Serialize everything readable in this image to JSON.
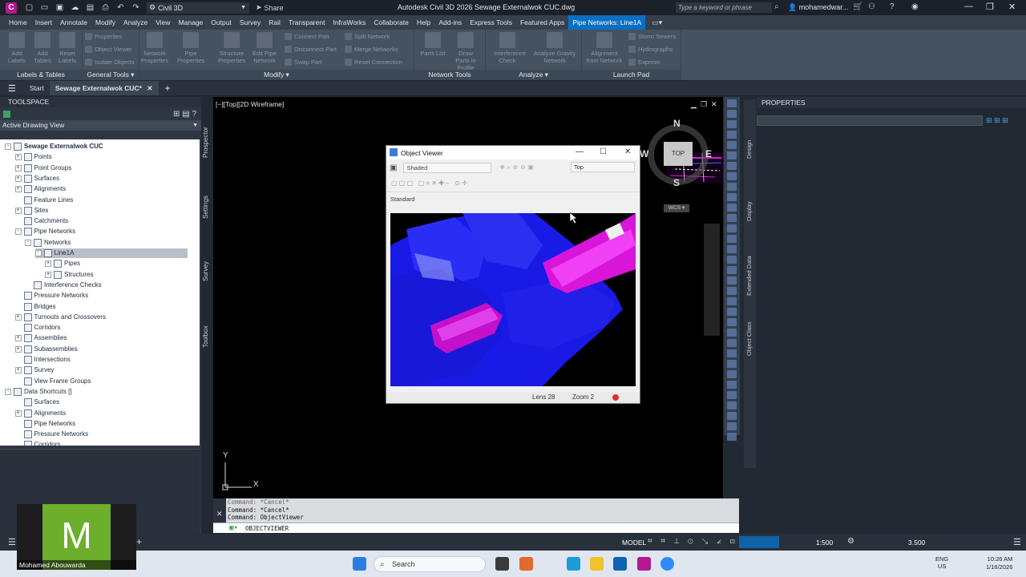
{
  "titlebar": {
    "app_letter": "C",
    "workspace": "Civil 3D",
    "share": "Share",
    "title": "Autodesk Civil 3D 2026   Sewage Externalwok CUC.dwg",
    "search_placeholder": "Type a keyword or phrase",
    "user": "mohamedwar..."
  },
  "ribbon_tabs": [
    "Home",
    "Insert",
    "Annotate",
    "Modify",
    "Analyze",
    "View",
    "Manage",
    "Output",
    "Survey",
    "Rail",
    "Transparent",
    "InfraWorks",
    "Collaborate",
    "Help",
    "Add-ins",
    "Express Tools",
    "Featured Apps",
    "Pipe Networks: Line1A"
  ],
  "ribbon": {
    "groups": [
      {
        "title": "Labels & Tables",
        "big": [
          "Add Labels",
          "Add Tables",
          "Reset Labels"
        ]
      },
      {
        "title": "General Tools ▾",
        "small": [
          "Properties",
          "Object Viewer",
          "Isolate Objects"
        ]
      },
      {
        "title": "Modify ▾",
        "big": [
          "Network Properties",
          "Pipe Properties",
          "Structure Properties",
          "Edit Pipe Network"
        ],
        "small": [
          "Connect Part",
          "Disconnect Part",
          "Swap Part",
          "Split Network",
          "Merge Networks",
          "Reset Connection"
        ]
      },
      {
        "title": "Network Tools",
        "big": [
          "Parts List",
          "Draw Parts in Profile"
        ]
      },
      {
        "title": "Analyze ▾",
        "big": [
          "Interference Check",
          "Analyze Gravity Network"
        ]
      },
      {
        "title": "Launch Pad",
        "big": [
          "Alignment from Network"
        ],
        "small": [
          "Storm Sewers",
          "Hydrographs",
          "Express"
        ]
      }
    ]
  },
  "file_tabs": [
    "Start",
    "Sewage Externalwok CUC*"
  ],
  "toolspace": {
    "title": "TOOLSPACE",
    "view_dropdown": "Active Drawing View",
    "tree": [
      {
        "label": "Sewage Externalwok CUC",
        "level": 0,
        "exp": "-",
        "bold": true
      },
      {
        "label": "Points",
        "level": 1,
        "exp": "+"
      },
      {
        "label": "Point Groups",
        "level": 1,
        "exp": "+"
      },
      {
        "label": "Surfaces",
        "level": 1,
        "exp": "+"
      },
      {
        "label": "Alignments",
        "level": 1,
        "exp": "+"
      },
      {
        "label": "Feature Lines",
        "level": 1,
        "exp": ""
      },
      {
        "label": "Sites",
        "level": 1,
        "exp": "+"
      },
      {
        "label": "Catchments",
        "level": 1,
        "exp": ""
      },
      {
        "label": "Pipe Networks",
        "level": 1,
        "exp": "-"
      },
      {
        "label": "Networks",
        "level": 2,
        "exp": "-"
      },
      {
        "label": "Line1A",
        "level": 3,
        "exp": "-",
        "selected": true
      },
      {
        "label": "Pipes",
        "level": 4,
        "exp": "+"
      },
      {
        "label": "Structures",
        "level": 4,
        "exp": "+"
      },
      {
        "label": "Interference Checks",
        "level": 2,
        "exp": ""
      },
      {
        "label": "Pressure Networks",
        "level": 1,
        "exp": ""
      },
      {
        "label": "Bridges",
        "level": 1,
        "exp": ""
      },
      {
        "label": "Turnouts and Crossovers",
        "level": 1,
        "exp": "+"
      },
      {
        "label": "Corridors",
        "level": 1,
        "exp": ""
      },
      {
        "label": "Assemblies",
        "level": 1,
        "exp": "+"
      },
      {
        "label": "Subassemblies",
        "level": 1,
        "exp": "+"
      },
      {
        "label": "Intersections",
        "level": 1,
        "exp": ""
      },
      {
        "label": "Survey",
        "level": 1,
        "exp": "+"
      },
      {
        "label": "View Frame Groups",
        "level": 1,
        "exp": ""
      },
      {
        "label": "Data Shortcuts []",
        "level": 0,
        "exp": "-"
      },
      {
        "label": "Surfaces",
        "level": 1,
        "exp": ""
      },
      {
        "label": "Alignments",
        "level": 1,
        "exp": "+"
      },
      {
        "label": "Pipe Networks",
        "level": 1,
        "exp": ""
      },
      {
        "label": "Pressure Networks",
        "level": 1,
        "exp": ""
      },
      {
        "label": "Corridors",
        "level": 1,
        "exp": ""
      }
    ],
    "side_tabs": [
      "Prospector",
      "Settings",
      "Survey",
      "Toolbox"
    ]
  },
  "viewport": {
    "label": "[−][Top][2D Wireframe]",
    "viewcube": {
      "n": "N",
      "w": "W",
      "s": "S",
      "e": "E",
      "top": "TOP",
      "wcs": "WCS ▾"
    },
    "ucs_y": "Y",
    "ucs_x": "X"
  },
  "object_viewer": {
    "title": "Object Viewer",
    "visual_style": "Shaded",
    "view": "Top",
    "standard": "Standard",
    "lens": "Lens 28",
    "zoom": "Zoom 2"
  },
  "properties": {
    "title": "PROPERTIES",
    "side_tabs": [
      "Design",
      "Display",
      "Extended Data",
      "Object Class"
    ]
  },
  "command": {
    "history": [
      "Command: *Cancel*",
      "Command: *Cancel*",
      "Command: ObjectViewer"
    ],
    "input": "OBJECTVIEWER"
  },
  "statusbar": {
    "model": "MODEL",
    "scale": "1:500",
    "value": "3.500"
  },
  "taskbar": {
    "search": "Search",
    "lang": "ENG",
    "region": "US",
    "time": "10:26 AM",
    "date": "1/16/2026"
  },
  "webcam": {
    "initial": "M",
    "name": "Mohamed Abouwarda"
  },
  "colors": {
    "accent": "#0a6fc2",
    "webcam_tile": "#6dae2c",
    "pipe_blue": "#1f1ff0",
    "pipe_magenta": "#e21ae6"
  }
}
